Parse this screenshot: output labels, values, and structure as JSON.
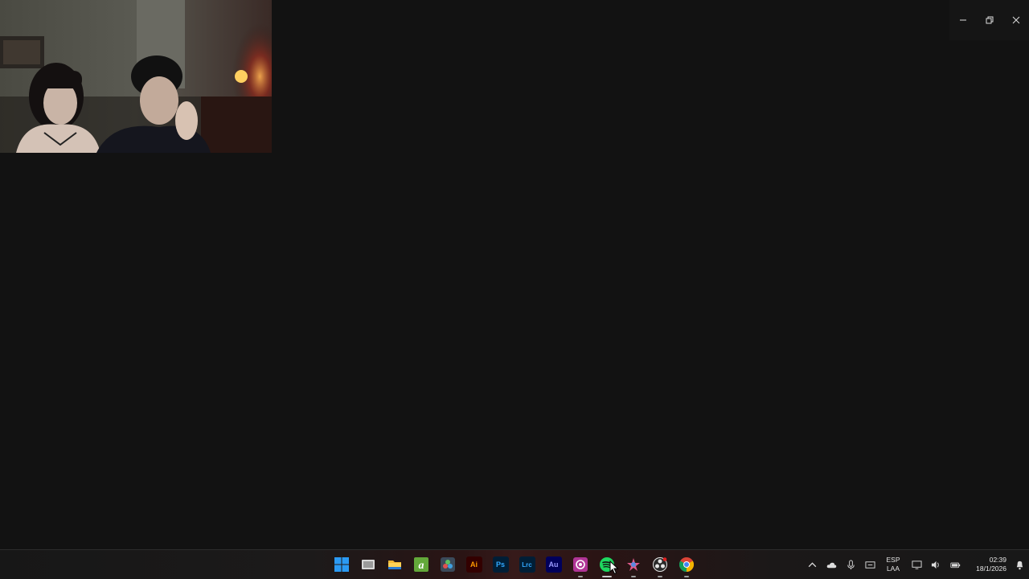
{
  "window_controls": {
    "minimize": "minimize",
    "restore": "restore",
    "close": "close"
  },
  "taskbar": {
    "pinned": [
      {
        "name": "start-menu-button",
        "icon": "windows-logo",
        "color": "#2b9af3"
      },
      {
        "name": "task-view-button",
        "icon": "task-view"
      },
      {
        "name": "file-explorer",
        "icon": "folder",
        "color": "#f2b835"
      },
      {
        "name": "app-green-a",
        "icon": "green-a",
        "color": "#63a83a"
      },
      {
        "name": "davinci-resolve",
        "icon": "davinci",
        "color": "#3b4a5a"
      },
      {
        "name": "adobe-illustrator",
        "label": "Ai",
        "color": "#ff9a00",
        "bg": "#330000"
      },
      {
        "name": "adobe-photoshop",
        "label": "Ps",
        "color": "#31a8ff",
        "bg": "#001e36"
      },
      {
        "name": "adobe-lightroom-classic",
        "label": "Lrc",
        "color": "#31a8ff",
        "bg": "#001e36"
      },
      {
        "name": "adobe-audition",
        "label": "Au",
        "color": "#9999ff",
        "bg": "#00005b"
      },
      {
        "name": "app-pink-camera",
        "icon": "camera",
        "color": "#d94ab5"
      },
      {
        "name": "spotify",
        "icon": "spotify",
        "color": "#1ed760"
      },
      {
        "name": "app-colorful-star",
        "icon": "star",
        "color": "#e05a8a"
      },
      {
        "name": "obs-studio",
        "icon": "obs",
        "color": "#e6e6e6"
      },
      {
        "name": "google-chrome",
        "icon": "chrome"
      }
    ],
    "tray": {
      "language": {
        "line1": "ESP",
        "line2": "LAA"
      },
      "clock": {
        "time": "02:39",
        "date": "18/1/2026"
      }
    }
  }
}
